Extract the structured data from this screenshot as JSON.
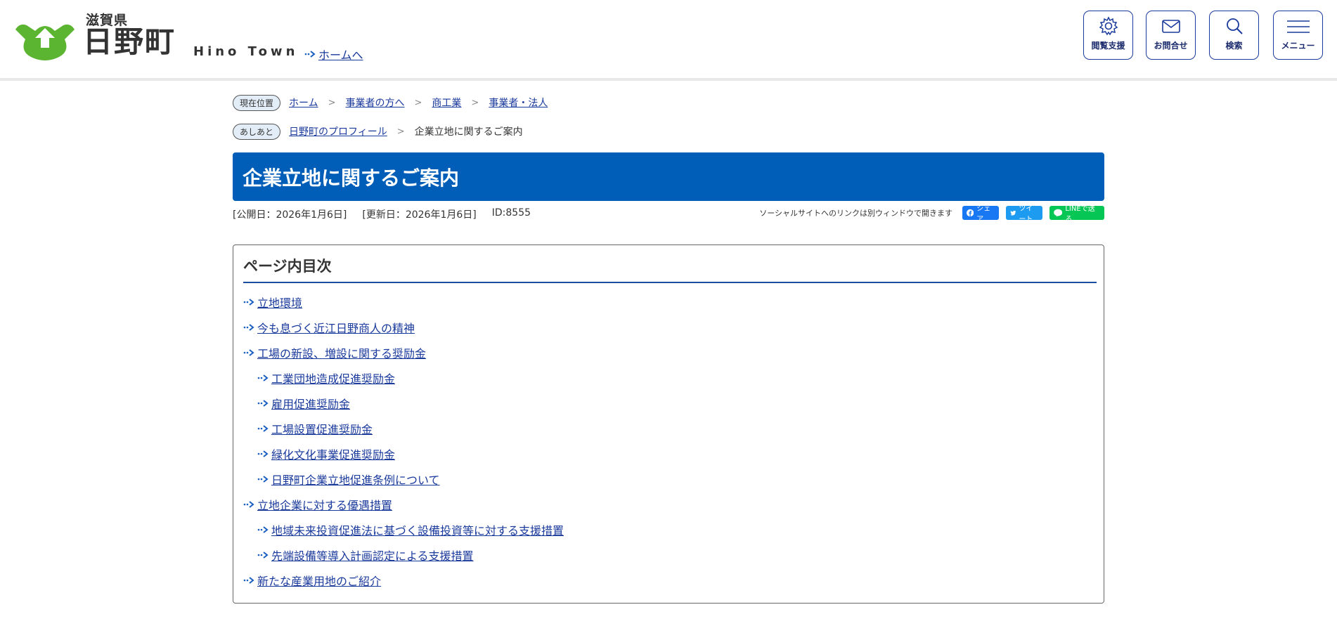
{
  "header": {
    "pref": "滋賀県",
    "town": "日野町",
    "town_en": "Hino Town",
    "home_link": "ホームへ",
    "buttons": {
      "accessibility": "閲覧支援",
      "contact": "お問合せ",
      "search": "検索",
      "menu": "メニュー"
    }
  },
  "breadcrumb": {
    "label": "現在位置",
    "items": [
      "ホーム",
      "事業者の方へ",
      "商工業",
      "事業者・法人"
    ]
  },
  "footprint": {
    "label": "あしあと",
    "items": [
      "日野町のプロフィール",
      "企業立地に関するご案内"
    ]
  },
  "page": {
    "title": "企業立地に関するご案内",
    "published": "[公開日：2026年1月6日]",
    "updated": "[更新日：2026年1月6日]",
    "id": "ID:8555"
  },
  "social": {
    "note": "ソーシャルサイトへのリンクは別ウィンドウで開きます",
    "facebook": "シェア",
    "twitter": "ツイート",
    "line": "LINEで送る"
  },
  "toc": {
    "heading": "ページ内目次",
    "items": [
      "立地環境",
      "今も息づく近江日野商人の精神",
      "工場の新設、増設に関する奨励金",
      "工業団地造成促進奨励金",
      "雇用促進奨励金",
      "工場設置促進奨励金",
      "緑化文化事業促進奨励金",
      "日野町企業立地促進条例について",
      "立地企業に対する優遇措置",
      "地域未来投資促進法に基づく設備投資等に対する支援措置",
      "先端設備等導入計画認定による支援措置",
      "新たな産業用地のご紹介"
    ]
  },
  "colors": {
    "title_bg": "#005eb8",
    "link": "#1a3a9c",
    "logo_green": "#5cb531",
    "facebook": "#1877f2",
    "twitter": "#1d9bf0",
    "line": "#06c755"
  }
}
